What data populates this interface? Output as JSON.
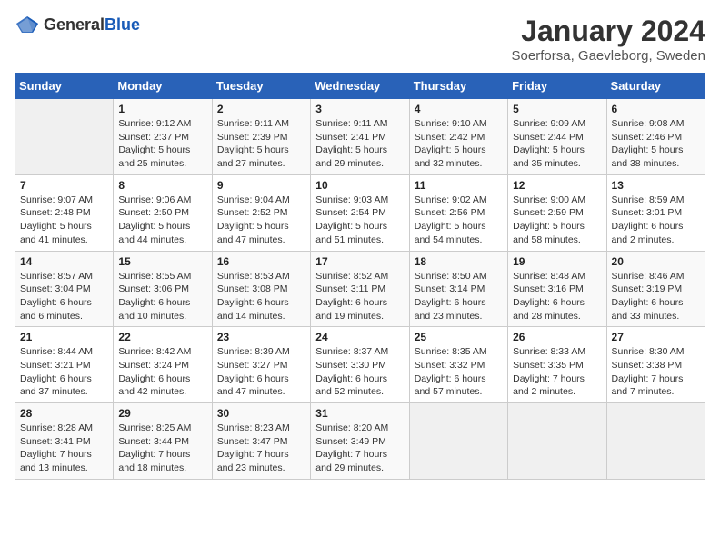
{
  "header": {
    "logo_general": "General",
    "logo_blue": "Blue",
    "title": "January 2024",
    "subtitle": "Soerforsa, Gaevleborg, Sweden"
  },
  "weekdays": [
    "Sunday",
    "Monday",
    "Tuesday",
    "Wednesday",
    "Thursday",
    "Friday",
    "Saturday"
  ],
  "weeks": [
    [
      {
        "day": "",
        "sunrise": "",
        "sunset": "",
        "daylight": ""
      },
      {
        "day": "1",
        "sunrise": "Sunrise: 9:12 AM",
        "sunset": "Sunset: 2:37 PM",
        "daylight": "Daylight: 5 hours and 25 minutes."
      },
      {
        "day": "2",
        "sunrise": "Sunrise: 9:11 AM",
        "sunset": "Sunset: 2:39 PM",
        "daylight": "Daylight: 5 hours and 27 minutes."
      },
      {
        "day": "3",
        "sunrise": "Sunrise: 9:11 AM",
        "sunset": "Sunset: 2:41 PM",
        "daylight": "Daylight: 5 hours and 29 minutes."
      },
      {
        "day": "4",
        "sunrise": "Sunrise: 9:10 AM",
        "sunset": "Sunset: 2:42 PM",
        "daylight": "Daylight: 5 hours and 32 minutes."
      },
      {
        "day": "5",
        "sunrise": "Sunrise: 9:09 AM",
        "sunset": "Sunset: 2:44 PM",
        "daylight": "Daylight: 5 hours and 35 minutes."
      },
      {
        "day": "6",
        "sunrise": "Sunrise: 9:08 AM",
        "sunset": "Sunset: 2:46 PM",
        "daylight": "Daylight: 5 hours and 38 minutes."
      }
    ],
    [
      {
        "day": "7",
        "sunrise": "Sunrise: 9:07 AM",
        "sunset": "Sunset: 2:48 PM",
        "daylight": "Daylight: 5 hours and 41 minutes."
      },
      {
        "day": "8",
        "sunrise": "Sunrise: 9:06 AM",
        "sunset": "Sunset: 2:50 PM",
        "daylight": "Daylight: 5 hours and 44 minutes."
      },
      {
        "day": "9",
        "sunrise": "Sunrise: 9:04 AM",
        "sunset": "Sunset: 2:52 PM",
        "daylight": "Daylight: 5 hours and 47 minutes."
      },
      {
        "day": "10",
        "sunrise": "Sunrise: 9:03 AM",
        "sunset": "Sunset: 2:54 PM",
        "daylight": "Daylight: 5 hours and 51 minutes."
      },
      {
        "day": "11",
        "sunrise": "Sunrise: 9:02 AM",
        "sunset": "Sunset: 2:56 PM",
        "daylight": "Daylight: 5 hours and 54 minutes."
      },
      {
        "day": "12",
        "sunrise": "Sunrise: 9:00 AM",
        "sunset": "Sunset: 2:59 PM",
        "daylight": "Daylight: 5 hours and 58 minutes."
      },
      {
        "day": "13",
        "sunrise": "Sunrise: 8:59 AM",
        "sunset": "Sunset: 3:01 PM",
        "daylight": "Daylight: 6 hours and 2 minutes."
      }
    ],
    [
      {
        "day": "14",
        "sunrise": "Sunrise: 8:57 AM",
        "sunset": "Sunset: 3:04 PM",
        "daylight": "Daylight: 6 hours and 6 minutes."
      },
      {
        "day": "15",
        "sunrise": "Sunrise: 8:55 AM",
        "sunset": "Sunset: 3:06 PM",
        "daylight": "Daylight: 6 hours and 10 minutes."
      },
      {
        "day": "16",
        "sunrise": "Sunrise: 8:53 AM",
        "sunset": "Sunset: 3:08 PM",
        "daylight": "Daylight: 6 hours and 14 minutes."
      },
      {
        "day": "17",
        "sunrise": "Sunrise: 8:52 AM",
        "sunset": "Sunset: 3:11 PM",
        "daylight": "Daylight: 6 hours and 19 minutes."
      },
      {
        "day": "18",
        "sunrise": "Sunrise: 8:50 AM",
        "sunset": "Sunset: 3:14 PM",
        "daylight": "Daylight: 6 hours and 23 minutes."
      },
      {
        "day": "19",
        "sunrise": "Sunrise: 8:48 AM",
        "sunset": "Sunset: 3:16 PM",
        "daylight": "Daylight: 6 hours and 28 minutes."
      },
      {
        "day": "20",
        "sunrise": "Sunrise: 8:46 AM",
        "sunset": "Sunset: 3:19 PM",
        "daylight": "Daylight: 6 hours and 33 minutes."
      }
    ],
    [
      {
        "day": "21",
        "sunrise": "Sunrise: 8:44 AM",
        "sunset": "Sunset: 3:21 PM",
        "daylight": "Daylight: 6 hours and 37 minutes."
      },
      {
        "day": "22",
        "sunrise": "Sunrise: 8:42 AM",
        "sunset": "Sunset: 3:24 PM",
        "daylight": "Daylight: 6 hours and 42 minutes."
      },
      {
        "day": "23",
        "sunrise": "Sunrise: 8:39 AM",
        "sunset": "Sunset: 3:27 PM",
        "daylight": "Daylight: 6 hours and 47 minutes."
      },
      {
        "day": "24",
        "sunrise": "Sunrise: 8:37 AM",
        "sunset": "Sunset: 3:30 PM",
        "daylight": "Daylight: 6 hours and 52 minutes."
      },
      {
        "day": "25",
        "sunrise": "Sunrise: 8:35 AM",
        "sunset": "Sunset: 3:32 PM",
        "daylight": "Daylight: 6 hours and 57 minutes."
      },
      {
        "day": "26",
        "sunrise": "Sunrise: 8:33 AM",
        "sunset": "Sunset: 3:35 PM",
        "daylight": "Daylight: 7 hours and 2 minutes."
      },
      {
        "day": "27",
        "sunrise": "Sunrise: 8:30 AM",
        "sunset": "Sunset: 3:38 PM",
        "daylight": "Daylight: 7 hours and 7 minutes."
      }
    ],
    [
      {
        "day": "28",
        "sunrise": "Sunrise: 8:28 AM",
        "sunset": "Sunset: 3:41 PM",
        "daylight": "Daylight: 7 hours and 13 minutes."
      },
      {
        "day": "29",
        "sunrise": "Sunrise: 8:25 AM",
        "sunset": "Sunset: 3:44 PM",
        "daylight": "Daylight: 7 hours and 18 minutes."
      },
      {
        "day": "30",
        "sunrise": "Sunrise: 8:23 AM",
        "sunset": "Sunset: 3:47 PM",
        "daylight": "Daylight: 7 hours and 23 minutes."
      },
      {
        "day": "31",
        "sunrise": "Sunrise: 8:20 AM",
        "sunset": "Sunset: 3:49 PM",
        "daylight": "Daylight: 7 hours and 29 minutes."
      },
      {
        "day": "",
        "sunrise": "",
        "sunset": "",
        "daylight": ""
      },
      {
        "day": "",
        "sunrise": "",
        "sunset": "",
        "daylight": ""
      },
      {
        "day": "",
        "sunrise": "",
        "sunset": "",
        "daylight": ""
      }
    ]
  ]
}
